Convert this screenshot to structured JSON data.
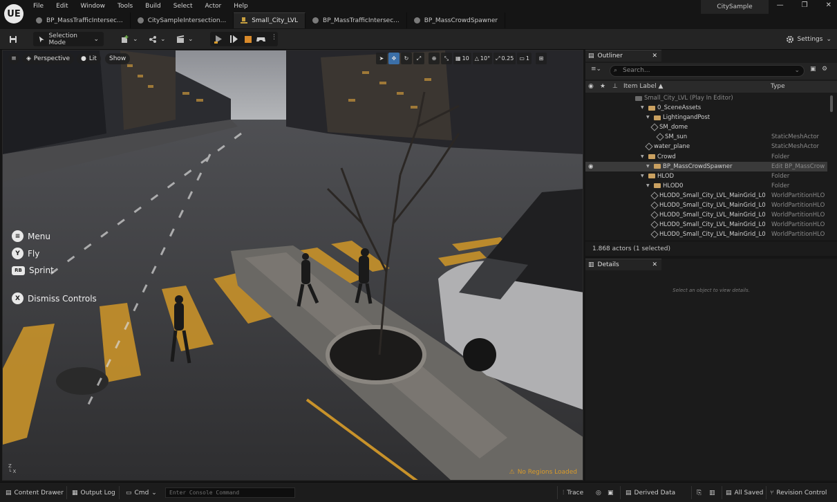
{
  "app": {
    "logo": "UE",
    "project": "CitySample",
    "window_controls": [
      "—",
      "❐",
      "✕"
    ]
  },
  "menu": [
    "File",
    "Edit",
    "Window",
    "Tools",
    "Build",
    "Select",
    "Actor",
    "Help"
  ],
  "tabs": [
    {
      "label": "BP_MassTrafficIntersec...",
      "active": false
    },
    {
      "label": "CitySampleIntersection...",
      "active": false
    },
    {
      "label": "Small_City_LVL",
      "active": true
    },
    {
      "label": "BP_MassTrafficIntersec...",
      "active": false
    },
    {
      "label": "BP_MassCrowdSpawner",
      "active": false
    }
  ],
  "toolbar": {
    "mode_label": "Selection Mode",
    "settings_label": "Settings"
  },
  "viewport": {
    "perspective_label": "Perspective",
    "lit_label": "Lit",
    "show_label": "Show",
    "camera_speed": "10",
    "angle": "10°",
    "scale": "0.25",
    "cam_count": "1",
    "controls": [
      {
        "key": "≡",
        "label": "Menu"
      },
      {
        "key": "Y",
        "label": "Fly"
      },
      {
        "key": "RB",
        "label": "Sprint"
      },
      {
        "key": "X",
        "label": "Dismiss Controls"
      }
    ],
    "warning": "No Regions Loaded",
    "axis_z": "Z",
    "axis_x": "X"
  },
  "outliner": {
    "tab_label": "Outliner",
    "search_placeholder": "Search...",
    "col_label": "Item Label ▲",
    "col_type": "Type",
    "rows": [
      {
        "label": "Small_City_LVL (Play In Editor)",
        "type": "",
        "indent": 0,
        "icon": "level",
        "muted": true
      },
      {
        "label": "0_SceneAssets",
        "type": "",
        "indent": 1,
        "icon": "folder"
      },
      {
        "label": "LightingandPost",
        "type": "",
        "indent": 2,
        "icon": "folder"
      },
      {
        "label": "SM_dome",
        "type": "",
        "indent": 3,
        "icon": "mesh"
      },
      {
        "label": "SM_sun",
        "type": "StaticMeshActor",
        "indent": 4,
        "icon": "mesh"
      },
      {
        "label": "water_plane",
        "type": "StaticMeshActor",
        "indent": 2,
        "icon": "mesh"
      },
      {
        "label": "Crowd",
        "type": "Folder",
        "indent": 1,
        "icon": "folder"
      },
      {
        "label": "BP_MassCrowdSpawner",
        "type": "Edit BP_MassCrow",
        "indent": 2,
        "icon": "folder",
        "selected": true
      },
      {
        "label": "HLOD",
        "type": "Folder",
        "indent": 1,
        "icon": "folder"
      },
      {
        "label": "HLOD0",
        "type": "Folder",
        "indent": 2,
        "icon": "folder"
      },
      {
        "label": "HLOD0_Small_City_LVL_MainGrid_L0",
        "type": "WorldPartitionHLO",
        "indent": 3,
        "icon": "mesh"
      },
      {
        "label": "HLOD0_Small_City_LVL_MainGrid_L0",
        "type": "WorldPartitionHLO",
        "indent": 3,
        "icon": "mesh"
      },
      {
        "label": "HLOD0_Small_City_LVL_MainGrid_L0",
        "type": "WorldPartitionHLO",
        "indent": 3,
        "icon": "mesh"
      },
      {
        "label": "HLOD0_Small_City_LVL_MainGrid_L0",
        "type": "WorldPartitionHLO",
        "indent": 3,
        "icon": "mesh"
      },
      {
        "label": "HLOD0_Small_City_LVL_MainGrid_L0",
        "type": "WorldPartitionHLO",
        "indent": 3,
        "icon": "mesh"
      }
    ],
    "footer": "1.868 actors (1 selected)"
  },
  "details": {
    "tab_label": "Details",
    "empty_text": "Select an object to view details."
  },
  "statusbar": {
    "content_drawer": "Content Drawer",
    "output_log": "Output Log",
    "cmd": "Cmd",
    "console_placeholder": "Enter Console Command",
    "trace": "Trace",
    "derived_data": "Derived Data",
    "all_saved": "All Saved",
    "revision_control": "Revision Control"
  },
  "colors": {
    "accent": "#3b6fa8",
    "folder": "#c9a060",
    "warning": "#d99b2a",
    "crosswalk": "#c8922a"
  }
}
